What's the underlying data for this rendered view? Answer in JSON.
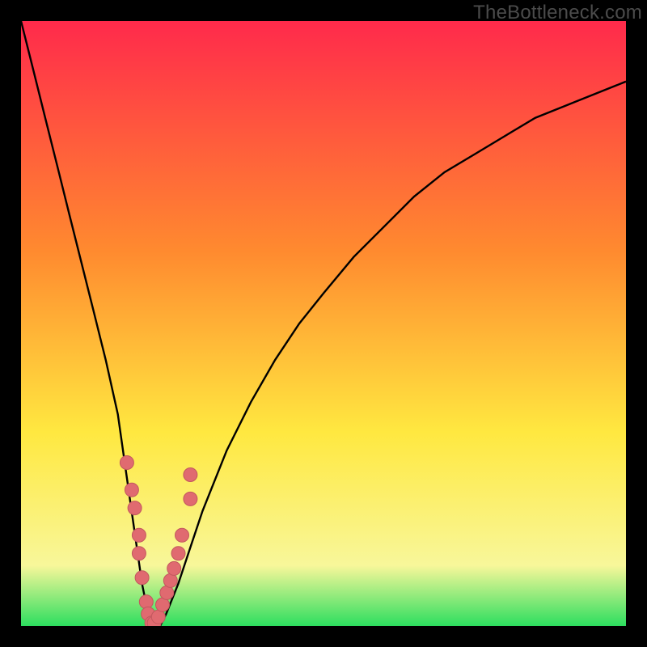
{
  "watermark": "TheBottleneck.com",
  "colors": {
    "bg": "#000000",
    "grad_top": "#ff2a4b",
    "grad_mid1": "#ff8a2f",
    "grad_mid2": "#ffe840",
    "grad_low": "#f8f79a",
    "grad_bottom": "#2dde5f",
    "curve": "#000000",
    "marker_fill": "#e06a70",
    "marker_stroke": "#c2585e"
  },
  "chart_data": {
    "type": "line",
    "title": "",
    "xlabel": "",
    "ylabel": "",
    "xlim": [
      0,
      100
    ],
    "ylim": [
      0,
      100
    ],
    "series": [
      {
        "name": "bottleneck-curve",
        "x": [
          0,
          2,
          4,
          6,
          8,
          10,
          12,
          14,
          16,
          18,
          19,
          20,
          21,
          22,
          23,
          24,
          26,
          28,
          30,
          34,
          38,
          42,
          46,
          50,
          55,
          60,
          65,
          70,
          75,
          80,
          85,
          90,
          95,
          100
        ],
        "y": [
          100,
          92,
          84,
          76,
          68,
          60,
          52,
          44,
          35,
          21,
          14,
          7,
          2,
          0,
          0,
          2,
          7,
          13,
          19,
          29,
          37,
          44,
          50,
          55,
          61,
          66,
          71,
          75,
          78,
          81,
          84,
          86,
          88,
          90
        ]
      }
    ],
    "markers": {
      "name": "highlighted-points",
      "x": [
        17.5,
        18.3,
        18.8,
        19.5,
        19.5,
        20.0,
        20.7,
        21.0,
        21.6,
        22.0,
        22.7,
        23.4,
        24.1,
        24.7,
        25.3,
        26.0,
        26.6,
        28.0,
        28.0
      ],
      "y": [
        27.0,
        22.5,
        19.5,
        15.0,
        12.0,
        8.0,
        4.0,
        2.0,
        0.5,
        0.5,
        1.5,
        3.5,
        5.5,
        7.5,
        9.5,
        12.0,
        15.0,
        21.0,
        25.0
      ]
    }
  }
}
